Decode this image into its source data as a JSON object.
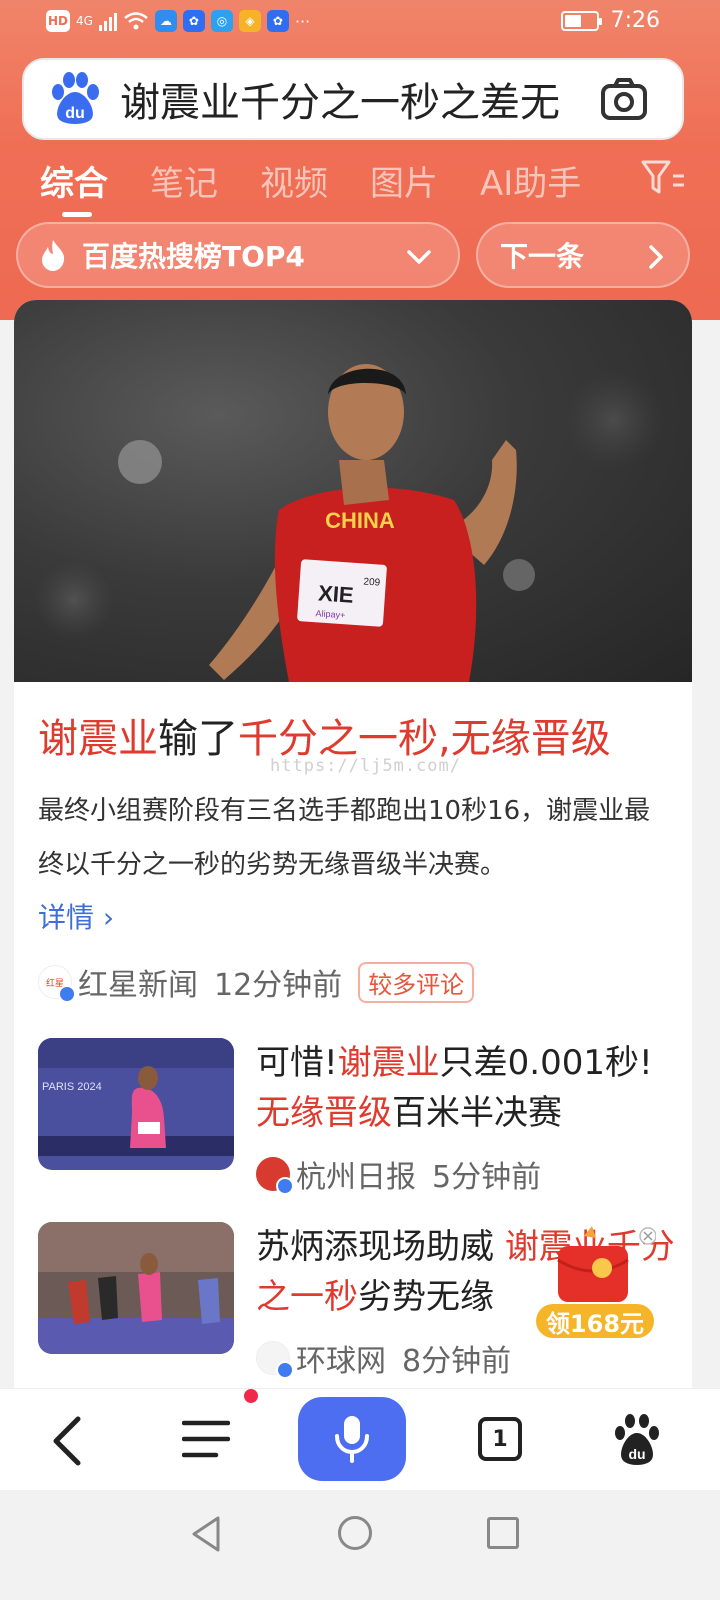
{
  "status_bar": {
    "hd_label": "HD",
    "network_label": "4G",
    "more_label": "···",
    "time": "7:26",
    "battery_level": 0.55
  },
  "search": {
    "query": "谢震业千分之一秒之差无"
  },
  "tabs": [
    {
      "label": "综合",
      "active": true
    },
    {
      "label": "笔记",
      "active": false
    },
    {
      "label": "视频",
      "active": false
    },
    {
      "label": "图片",
      "active": false
    },
    {
      "label": "AI助手",
      "active": false
    }
  ],
  "hot_chip": {
    "label": "百度热搜榜TOP4"
  },
  "next_chip": {
    "label": "下一条"
  },
  "main_card": {
    "hero_text": {
      "jersey_country": "CHINA",
      "bib_name": "XIE",
      "bib_number": "209",
      "bib_sponsor": "Alipay+"
    },
    "headline": {
      "part1": "谢震业",
      "part2": "输了",
      "part3": "千分之一秒",
      "part4": ",",
      "part5": "无缘晋级"
    },
    "watermark": "https://lj5m.com/",
    "summary": "最终小组赛阶段有三名选手都跑出10秒16，谢震业最终以千分之一秒的劣势无缘晋级半决赛。",
    "details_link": "详情 ›",
    "source": "红星新闻",
    "time": "12分钟前",
    "badge": "较多评论"
  },
  "news_items": [
    {
      "title_parts": [
        "可惜!",
        "谢震业",
        "只差0.001秒!",
        "无缘晋级",
        "百米半决赛"
      ],
      "source": "杭州日报",
      "time": "5分钟前",
      "thumb_text": "PARIS 2024"
    },
    {
      "title_parts": [
        "苏炳添现场助威 ",
        "谢震业",
        "千分之一秒",
        "劣势无缘"
      ],
      "source": "环球网",
      "time": "8分钟前"
    }
  ],
  "red_packet": {
    "label": "领168元"
  },
  "bottom_nav": {
    "tab_count": "1"
  },
  "colors": {
    "accent": "#ef6f55",
    "highlight": "#e03a2e",
    "link": "#3f6fd6",
    "mic": "#4e6ef2"
  }
}
